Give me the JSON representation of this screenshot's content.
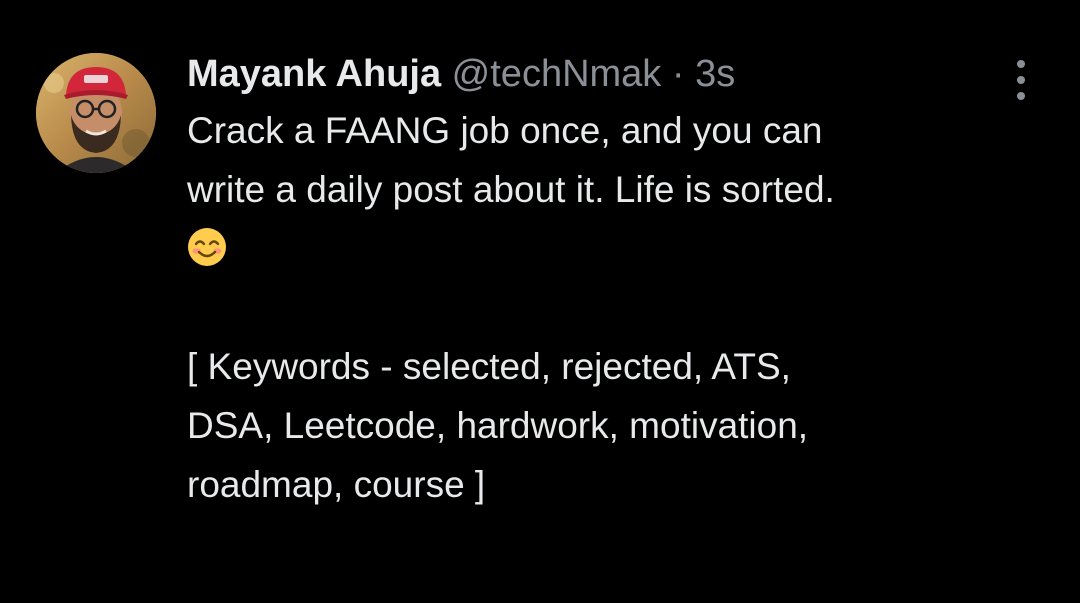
{
  "tweet": {
    "author": {
      "display_name": "Mayank Ahuja",
      "handle": "@techNmak",
      "separator": "·",
      "timestamp": "3s"
    },
    "text_lines": [
      "Crack a FAANG job once, and you can",
      "write a daily post about it. Life is sorted."
    ],
    "emoji": "smiling-face-emoji",
    "keyword_lines": [
      "[ Keywords - selected, rejected, ATS,",
      "DSA, Leetcode, hardwork, motivation,",
      "roadmap, course ]"
    ],
    "more_icon": "more-vertical-icon"
  },
  "colors": {
    "background": "#000000",
    "primary_text": "#e7e9ea",
    "secondary_text": "#8b9096",
    "emoji_yellow": "#ffcc4d"
  }
}
